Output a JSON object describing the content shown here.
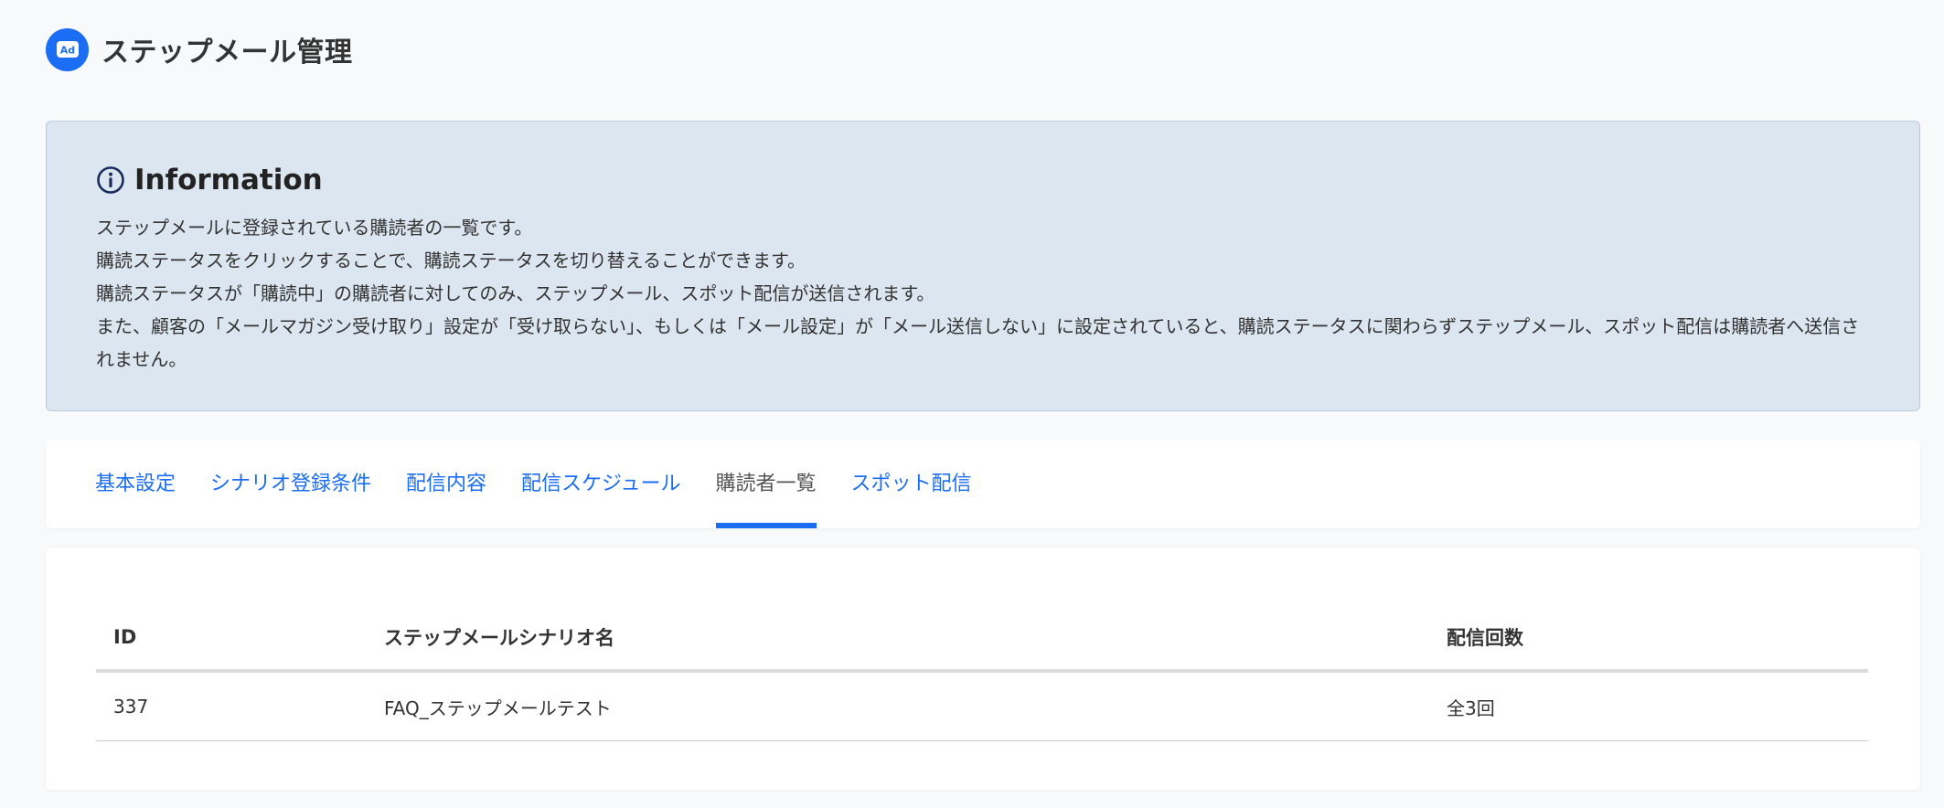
{
  "header": {
    "logo_text": "Ad",
    "title": "ステップメール管理"
  },
  "info": {
    "icon": "info-circle-icon",
    "title": "Information",
    "lines": [
      "ステップメールに登録されている購読者の一覧です。",
      "購読ステータスをクリックすることで、購読ステータスを切り替えることができます。",
      "購読ステータスが「購読中」の購読者に対してのみ、ステップメール、スポット配信が送信されます。",
      "また、顧客の「メールマガジン受け取り」設定が「受け取らない」、もしくは「メール設定」が「メール送信しない」に設定されていると、購読ステータスに関わらずステップメール、スポット配信は購読者へ送信されません。"
    ]
  },
  "tabs": [
    {
      "label": "基本設定",
      "active": false
    },
    {
      "label": "シナリオ登録条件",
      "active": false
    },
    {
      "label": "配信内容",
      "active": false
    },
    {
      "label": "配信スケジュール",
      "active": false
    },
    {
      "label": "購読者一覧",
      "active": true
    },
    {
      "label": "スポット配信",
      "active": false
    }
  ],
  "table": {
    "columns": [
      "ID",
      "ステップメールシナリオ名",
      "配信回数"
    ],
    "rows": [
      [
        "337",
        "FAQ_ステップメールテスト",
        "全3回"
      ]
    ]
  },
  "colors": {
    "accent": "#1b6ef3",
    "info_bg": "#dce6f0",
    "page_bg": "#f7f9fb"
  }
}
